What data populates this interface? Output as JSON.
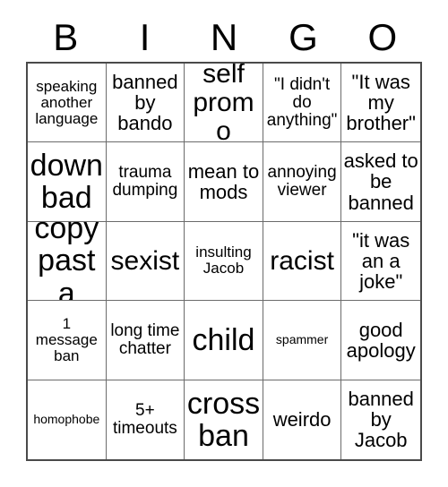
{
  "card": {
    "header_letters": [
      "B",
      "I",
      "N",
      "G",
      "O"
    ],
    "columns": 5,
    "rows": 5,
    "grid_border_color": "#4a4a4a",
    "cell_border_color": "#6b6b6b",
    "background_color": "#ffffff",
    "text_color": "#000000",
    "cells": [
      {
        "text": "speaking another language",
        "size": "fs-xs"
      },
      {
        "text": "banned by bando",
        "size": "fs-md"
      },
      {
        "text": "self promo",
        "size": "fs-lg"
      },
      {
        "text": "\"I didn't do anything\"",
        "size": "fs-sm"
      },
      {
        "text": "\"It was my brother\"",
        "size": "fs-md"
      },
      {
        "text": "down bad",
        "size": "fs-xl"
      },
      {
        "text": "trauma dumping",
        "size": "fs-sm"
      },
      {
        "text": "mean to mods",
        "size": "fs-md"
      },
      {
        "text": "annoying viewer",
        "size": "fs-sm"
      },
      {
        "text": "asked to be banned",
        "size": "fs-md"
      },
      {
        "text": "copy pasta",
        "size": "fs-xl"
      },
      {
        "text": "sexist",
        "size": "fs-lg"
      },
      {
        "text": "insulting Jacob",
        "size": "fs-xs"
      },
      {
        "text": "racist",
        "size": "fs-lg"
      },
      {
        "text": "\"it was an a joke\"",
        "size": "fs-md"
      },
      {
        "text": "1 message ban",
        "size": "fs-xs"
      },
      {
        "text": "long time chatter",
        "size": "fs-sm"
      },
      {
        "text": "child",
        "size": "fs-xl"
      },
      {
        "text": "spammer",
        "size": "fs-xxs"
      },
      {
        "text": "good apology",
        "size": "fs-md"
      },
      {
        "text": "homophobe",
        "size": "fs-xxs"
      },
      {
        "text": "5+ timeouts",
        "size": "fs-sm"
      },
      {
        "text": "cross ban",
        "size": "fs-xl"
      },
      {
        "text": "weirdo",
        "size": "fs-md"
      },
      {
        "text": "banned by Jacob",
        "size": "fs-md"
      }
    ]
  }
}
